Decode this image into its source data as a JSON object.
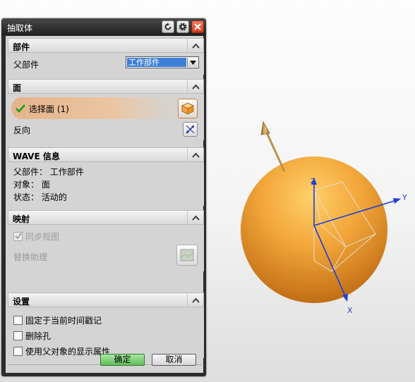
{
  "dialog": {
    "title": "抽取体",
    "section_part": {
      "heading": "部件",
      "parent_label": "父部件",
      "parent_value": "工作部件"
    },
    "section_face": {
      "heading": "面",
      "select_label": "选择面 (1)",
      "reverse_label": "反向"
    },
    "section_wave": {
      "heading": "WAVE 信息",
      "lines": [
        "父部件： 工作部件",
        "对象： 面",
        "状态： 活动的"
      ]
    },
    "section_mapping": {
      "heading": "映射",
      "sync_view_label": "同步视图",
      "sync_view_checked": true,
      "replace_assistant_label": "替换助理"
    },
    "section_settings": {
      "heading": "设置",
      "options": [
        {
          "label": "固定于当前时间戳记",
          "checked": false
        },
        {
          "label": "删除孔",
          "checked": false
        },
        {
          "label": "使用父对象的显示属性",
          "checked": false
        }
      ]
    },
    "ok_label": "确定",
    "cancel_label": "取消"
  },
  "viewport": {
    "axis_labels": {
      "x": "X",
      "y": "Y",
      "z": "Z"
    },
    "object": "sphere",
    "colors": {
      "sphere": "#f0a535",
      "axis": "#1b3fd8",
      "normal_arrow": "#b9914b"
    }
  },
  "icons": [
    "reset-icon",
    "gear-icon",
    "close-icon",
    "chevron-up-icon",
    "dropdown-arrow-icon",
    "checkmark-icon",
    "face-select-icon",
    "reverse-direction-icon",
    "replace-assistant-icon"
  ]
}
